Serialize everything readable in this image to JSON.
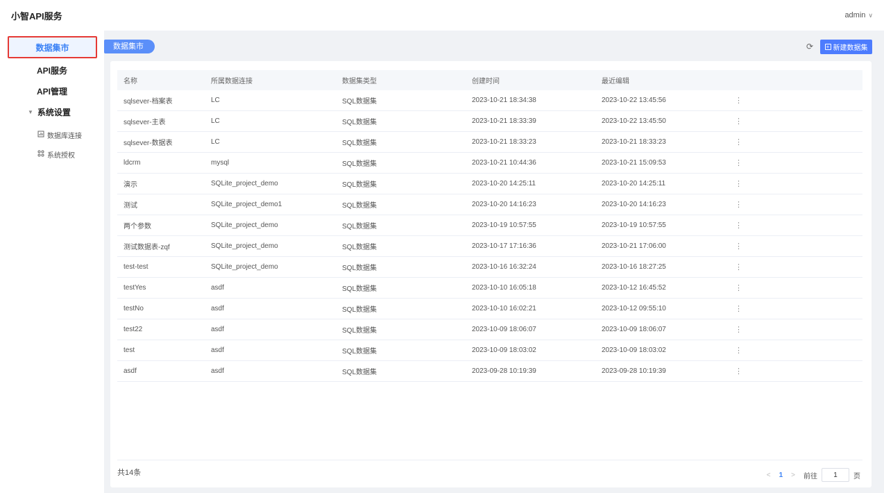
{
  "header": {
    "app_title": "小智API服务",
    "user": "admin",
    "user_caret": "∨"
  },
  "sidebar": {
    "items": [
      {
        "label": "数据集市"
      },
      {
        "label": "API服务"
      },
      {
        "label": "API管理"
      }
    ],
    "group": {
      "label": "系统设置",
      "caret": "▼"
    },
    "sub_items": [
      {
        "label": "数据库连接",
        "icon": "database-icon"
      },
      {
        "label": "系统授权",
        "icon": "auth-icon"
      }
    ]
  },
  "breadcrumb": {
    "label": "数据集市"
  },
  "toolbar": {
    "new_label": "新建数据集",
    "plus": "+",
    "refresh_glyph": "⟳"
  },
  "table": {
    "headers": [
      "名称",
      "所属数据连接",
      "数据集类型",
      "创建时间",
      "最近编辑"
    ],
    "more_glyph": "⋮",
    "rows": [
      [
        "sqlsever-档案表",
        "LC",
        "SQL数据集",
        "2023-10-21 18:34:38",
        "2023-10-22 13:45:56"
      ],
      [
        "sqlsever-主表",
        "LC",
        "SQL数据集",
        "2023-10-21 18:33:39",
        "2023-10-22 13:45:50"
      ],
      [
        "sqlsever-数据表",
        "LC",
        "SQL数据集",
        "2023-10-21 18:33:23",
        "2023-10-21 18:33:23"
      ],
      [
        "ldcrm",
        "mysql",
        "SQL数据集",
        "2023-10-21 10:44:36",
        "2023-10-21 15:09:53"
      ],
      [
        "演示",
        "SQLite_project_demo",
        "SQL数据集",
        "2023-10-20 14:25:11",
        "2023-10-20 14:25:11"
      ],
      [
        "测试",
        "SQLite_project_demo1",
        "SQL数据集",
        "2023-10-20 14:16:23",
        "2023-10-20 14:16:23"
      ],
      [
        "两个参数",
        "SQLite_project_demo",
        "SQL数据集",
        "2023-10-19 10:57:55",
        "2023-10-19 10:57:55"
      ],
      [
        "测试数据表-zqf",
        "SQLite_project_demo",
        "SQL数据集",
        "2023-10-17 17:16:36",
        "2023-10-21 17:06:00"
      ],
      [
        "test-test",
        "SQLite_project_demo",
        "SQL数据集",
        "2023-10-16 16:32:24",
        "2023-10-16 18:27:25"
      ],
      [
        "testYes",
        "asdf",
        "SQL数据集",
        "2023-10-10 16:05:18",
        "2023-10-12 16:45:52"
      ],
      [
        "testNo",
        "asdf",
        "SQL数据集",
        "2023-10-10 16:02:21",
        "2023-10-12 09:55:10"
      ],
      [
        "test22",
        "asdf",
        "SQL数据集",
        "2023-10-09 18:06:07",
        "2023-10-09 18:06:07"
      ],
      [
        "test",
        "asdf",
        "SQL数据集",
        "2023-10-09 18:03:02",
        "2023-10-09 18:03:02"
      ],
      [
        "asdf",
        "asdf",
        "SQL数据集",
        "2023-09-28 10:19:39",
        "2023-09-28 10:19:39"
      ]
    ]
  },
  "pagination": {
    "total": "共14条",
    "prev": "<",
    "current": "1",
    "next": ">",
    "goto_label": "前往",
    "goto_value": "1",
    "page_suffix": "页"
  },
  "colors": {
    "accent": "#4d7cfe",
    "highlight_border": "#e53935",
    "tag": "#5b8ff9"
  }
}
